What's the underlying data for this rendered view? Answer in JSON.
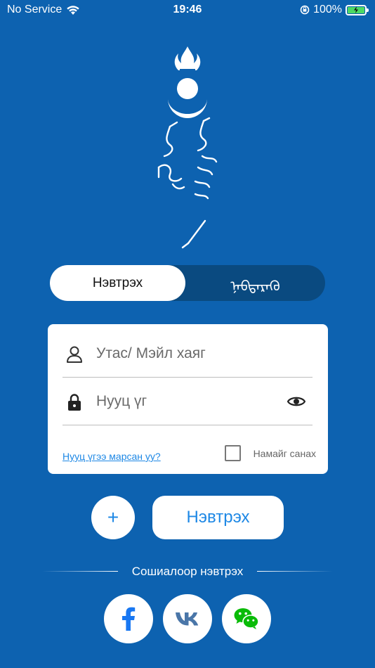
{
  "status_bar": {
    "carrier": "No Service",
    "time": "19:46",
    "battery_percent": "100%"
  },
  "logo": {
    "icon": "soyombo-logo-icon"
  },
  "segment": {
    "active_label": "Нэвтрэх",
    "inactive_label": "ᠨᠡᠪᠲᠡᠷᠡᠬᠦ"
  },
  "login_form": {
    "username_placeholder": "Утас/ Мэйл хаяг",
    "password_placeholder": "Нууц үг",
    "forgot_password": "Нууц үгээ марсан уу?",
    "remember_me": "Намайг санах",
    "remember_checked": false
  },
  "actions": {
    "plus_label": "+",
    "login_label": "Нэвтрэх"
  },
  "social": {
    "label": "Сошиалоор нэвтрэх",
    "providers": [
      "facebook-icon",
      "vk-icon",
      "wechat-icon"
    ]
  },
  "colors": {
    "background": "#0d62b0",
    "segment_bg": "#0a4a80",
    "accent": "#1e88e5",
    "facebook": "#1877f2",
    "vk": "#4a76a8",
    "wechat": "#09bb07"
  }
}
